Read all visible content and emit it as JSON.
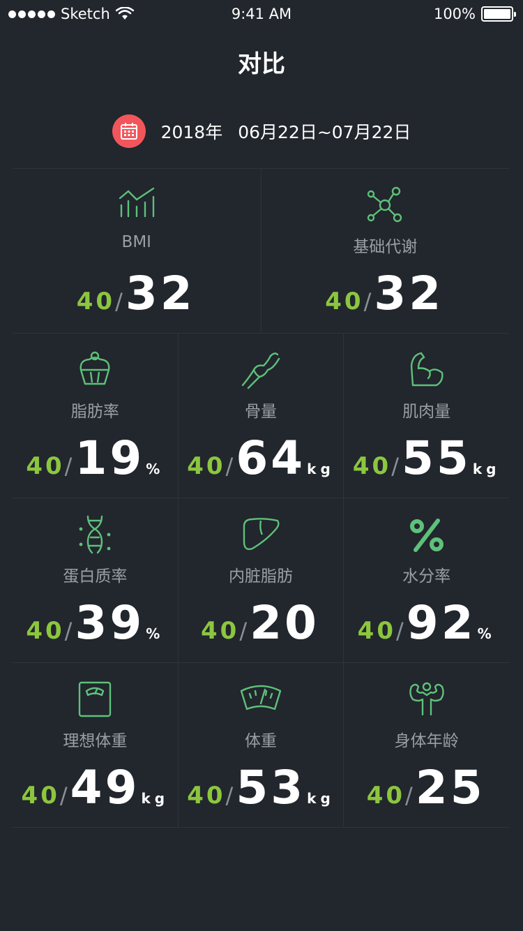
{
  "status": {
    "carrier": "Sketch",
    "time": "9:41 AM",
    "battery": "100%"
  },
  "title": "对比",
  "date": {
    "year": "2018年",
    "range": "06月22日~07月22日"
  },
  "metrics": [
    {
      "label": "BMI",
      "base": "40",
      "value": "32",
      "unit": "",
      "icon": "chart-icon"
    },
    {
      "label": "基础代谢",
      "base": "40",
      "value": "32",
      "unit": "",
      "icon": "molecule-icon"
    },
    {
      "label": "脂肪率",
      "base": "40",
      "value": "19",
      "unit": "%",
      "icon": "cupcake-icon"
    },
    {
      "label": "骨量",
      "base": "40",
      "value": "64",
      "unit": "kg",
      "icon": "bone-icon"
    },
    {
      "label": "肌肉量",
      "base": "40",
      "value": "55",
      "unit": "kg",
      "icon": "muscle-icon"
    },
    {
      "label": "蛋白质率",
      "base": "40",
      "value": "39",
      "unit": "%",
      "icon": "dna-icon"
    },
    {
      "label": "内脏脂肪",
      "base": "40",
      "value": "20",
      "unit": "",
      "icon": "liver-icon"
    },
    {
      "label": "水分率",
      "base": "40",
      "value": "92",
      "unit": "%",
      "icon": "percent-icon"
    },
    {
      "label": "理想体重",
      "base": "40",
      "value": "49",
      "unit": "kg",
      "icon": "scale-icon"
    },
    {
      "label": "体重",
      "base": "40",
      "value": "53",
      "unit": "kg",
      "icon": "gauge-icon"
    },
    {
      "label": "身体年龄",
      "base": "40",
      "value": "25",
      "unit": "",
      "icon": "bodybuilder-icon"
    }
  ],
  "colors": {
    "background": "#22262d",
    "accent": "#8cc63f",
    "icon_green": "#5ec17a",
    "calendar": "#f2565b"
  }
}
